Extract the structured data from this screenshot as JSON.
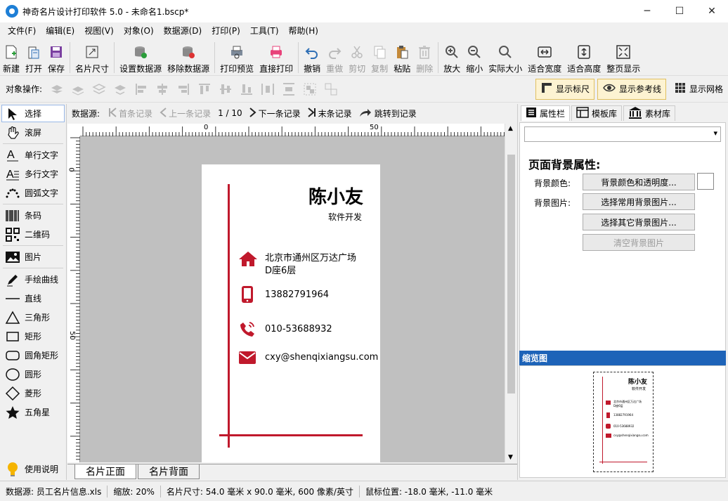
{
  "window": {
    "title": "神奇名片设计打印软件 5.0 - 未命名1.bscp*",
    "minimize": "─",
    "maximize": "☐",
    "close": "✕"
  },
  "menu": [
    "文件(F)",
    "编辑(E)",
    "视图(V)",
    "对象(O)",
    "数据源(D)",
    "打印(P)",
    "工具(T)",
    "帮助(H)"
  ],
  "toolbar": {
    "new": "新建",
    "open": "打开",
    "save": "保存",
    "card_size": "名片尺寸",
    "set_datasource": "设置数据源",
    "remove_datasource": "移除数据源",
    "print_preview": "打印预览",
    "direct_print": "直接打印",
    "undo": "撤销",
    "redo": "重做",
    "cut": "剪切",
    "copy": "复制",
    "paste": "粘贴",
    "delete": "删除",
    "zoom_in": "放大",
    "zoom_out": "缩小",
    "actual_size": "实际大小",
    "fit_width": "适合宽度",
    "fit_height": "适合高度",
    "full_page": "整页显示"
  },
  "objbar": {
    "label": "对象操作:",
    "show_ruler": "显示标尺",
    "show_guides": "显示参考线",
    "show_grid": "显示网格"
  },
  "tools": {
    "select": "选择",
    "pan": "滚屏",
    "single_text": "单行文字",
    "multi_text": "多行文字",
    "arc_text": "圆弧文字",
    "barcode": "条码",
    "qrcode": "二维码",
    "image": "图片",
    "freehand": "手绘曲线",
    "line": "直线",
    "triangle": "三角形",
    "rect": "矩形",
    "round_rect": "圆角矩形",
    "circle": "圆形",
    "diamond": "菱形",
    "star": "五角星",
    "help": "使用说明"
  },
  "nav": {
    "label": "数据源:",
    "first": "首条记录",
    "prev": "上一条记录",
    "pos": "1 / 10",
    "next": "下一条记录",
    "last": "末条记录",
    "jump": "跳转到记录"
  },
  "ruler": {
    "h0": "0",
    "h50": "50",
    "v0": "0",
    "v50": "50"
  },
  "card": {
    "name": "陈小友",
    "job": "软件开发",
    "address_line1": "北京市通州区万达广场",
    "address_line2": "D座6层",
    "mobile": "13882791964",
    "phone": "010-53688932",
    "email": "cxy@shenqixiangsu.com"
  },
  "tabs": {
    "front": "名片正面",
    "back": "名片背面"
  },
  "rightpanel": {
    "tab_props": "属性栏",
    "tab_templates": "模板库",
    "tab_assets": "素材库",
    "section_title": "页面背景属性:",
    "bg_color_label": "背景颜色:",
    "bg_color_btn": "背景颜色和透明度...",
    "bg_image_label": "背景图片:",
    "common_bg_btn": "选择常用背景图片...",
    "other_bg_btn": "选择其它背景图片...",
    "clear_bg_btn": "清空背景图片",
    "thumbnail_title": "缩览图"
  },
  "status": {
    "datasource": "数据源: 员工名片信息.xls",
    "zoom": "缩放: 20%",
    "size": "名片尺寸: 54.0 毫米 x 90.0 毫米, 600 像素/英寸",
    "mouse": "鼠标位置: -18.0 毫米, -11.0 毫米"
  },
  "colors": {
    "accent": "#c0192c",
    "select_blue": "#1d63b8"
  }
}
